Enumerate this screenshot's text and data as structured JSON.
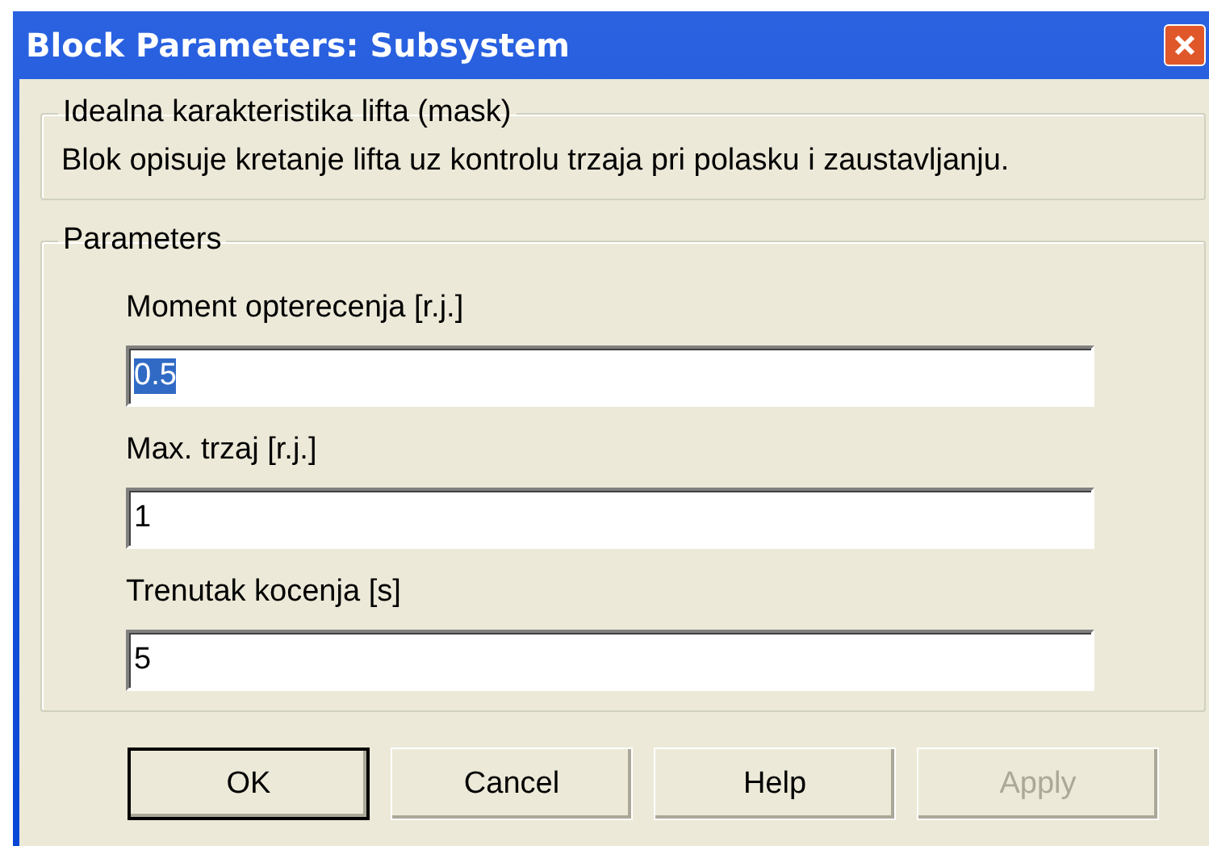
{
  "window": {
    "title": "Block Parameters: Subsystem"
  },
  "description_group": {
    "title": "Idealna karakteristika lifta (mask)",
    "text": "Blok opisuje kretanje lifta uz kontrolu trzaja pri polasku i zaustavljanju."
  },
  "parameters_group": {
    "title": "Parameters",
    "fields": [
      {
        "label": "Moment opterecenja [r.j.]",
        "value": "0.5",
        "text_selected": true
      },
      {
        "label": "Max. trzaj [r.j.]",
        "value": "1",
        "text_selected": false
      },
      {
        "label": "Trenutak kocenja [s]",
        "value": "5",
        "text_selected": false
      }
    ]
  },
  "buttons": [
    {
      "label": "OK",
      "default": true,
      "disabled": false
    },
    {
      "label": "Cancel",
      "default": false,
      "disabled": false
    },
    {
      "label": "Help",
      "default": false,
      "disabled": false
    },
    {
      "label": "Apply",
      "default": false,
      "disabled": true
    }
  ]
}
